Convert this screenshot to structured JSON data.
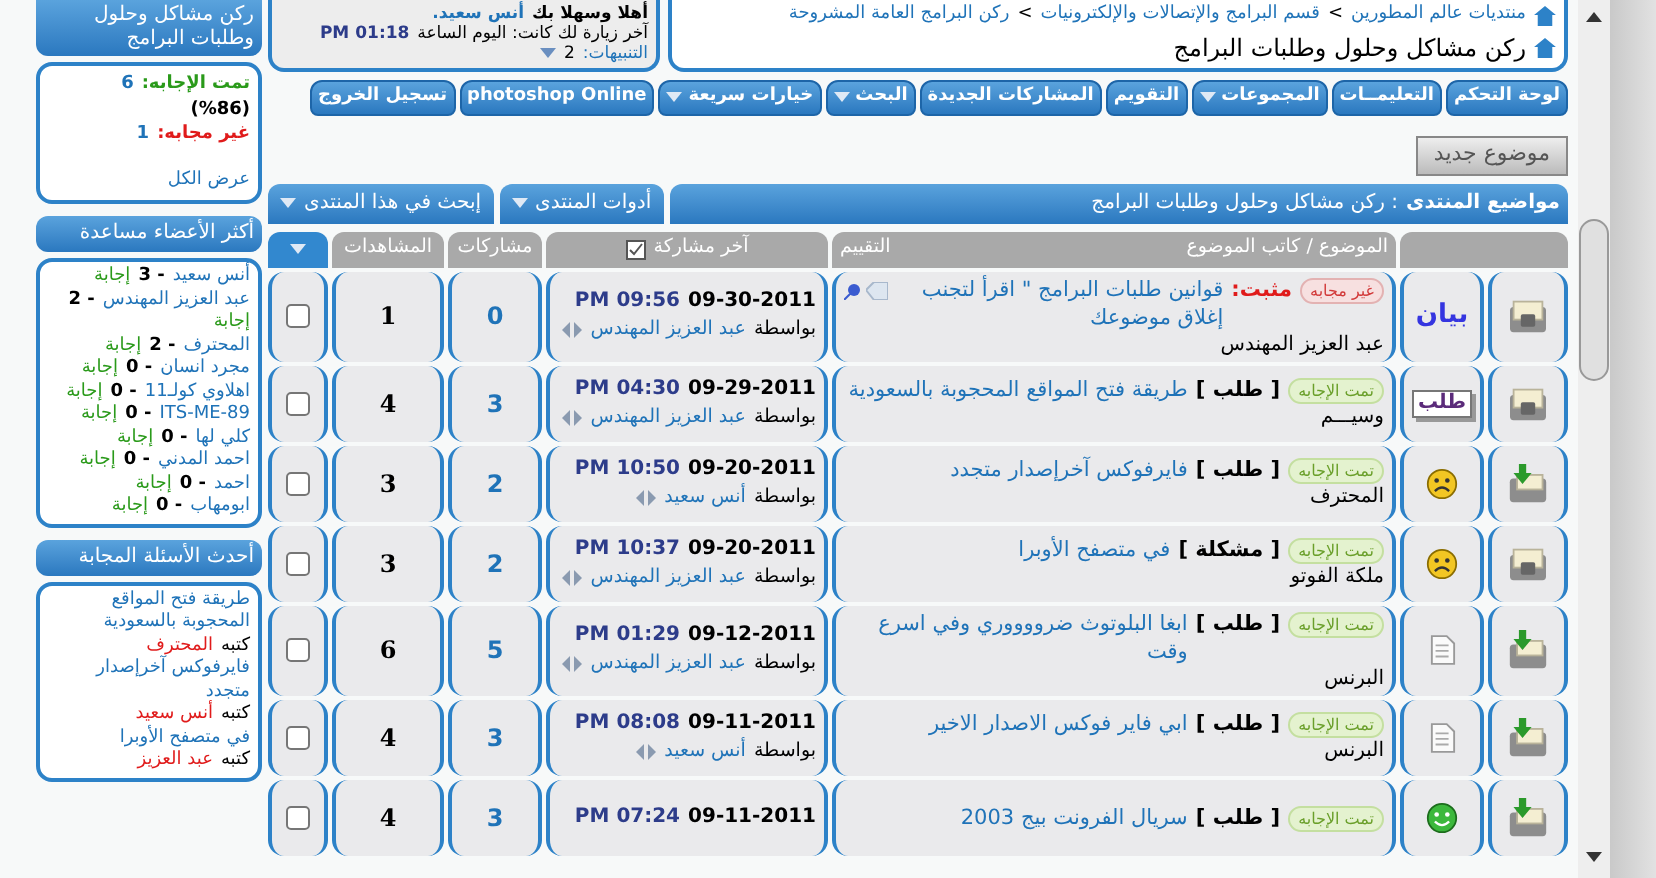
{
  "breadcrumb": {
    "links": [
      "منتديات عالم المطورين",
      "قسم البرامج والإتصالات والإلكترونيات",
      "ركن البرامج العامة المشروحة"
    ],
    "separator": ">",
    "current": "ركن مشاكل وحلول وطلبات البرامج"
  },
  "welcome": {
    "greeting": "أهلا وسهلا بك",
    "user": "أنس سعيد.",
    "last_visit_label": "آخر زيارة لك كانت: اليوم الساعة",
    "last_visit_time": "01:18 PM",
    "notifications_label": "التنبيهات:",
    "notifications_count": "2"
  },
  "navbar": [
    {
      "label": "لوحة التحكم",
      "dropdown": false
    },
    {
      "label": "التعليمــات",
      "dropdown": false
    },
    {
      "label": "المجموعات",
      "dropdown": true
    },
    {
      "label": "التقويم",
      "dropdown": false
    },
    {
      "label": "المشاركات الجديدة",
      "dropdown": false
    },
    {
      "label": "البحث",
      "dropdown": true
    },
    {
      "label": "خيارات سريعة",
      "dropdown": true
    },
    {
      "label": "photoshop Online",
      "dropdown": false
    },
    {
      "label": "تسجيل الخروج",
      "dropdown": false
    }
  ],
  "new_topic_button": "موضوع جديد",
  "forum_bar": {
    "label": "مواضيع المنتدى",
    "title": ": ركن مشاكل وحلول وطلبات البرامج",
    "buttons": [
      {
        "label": "أدوات المنتدى",
        "dropdown": true
      },
      {
        "label": "إبحث في هذا المنتدى",
        "dropdown": true
      }
    ]
  },
  "table": {
    "columns": {
      "subject": "الموضوع / كاتب الموضوع",
      "rating": "التقييم",
      "last_post": "آخر مشاركة",
      "posts": "مشاركات",
      "views": "المشاهدات"
    },
    "rows": [
      {
        "kind": "locked",
        "prefix": {
          "kind": "text",
          "label": "بيان"
        },
        "badge": {
          "kind": "unanswered",
          "label": "غير مجابه"
        },
        "sticky": "مثبت:",
        "title": "قوانين طلبات البرامج \" اقرأ لتجنب إغلاق موضوعك",
        "author": "عبد العزيز المهندس",
        "pinned": true,
        "date": "09-30-2011",
        "time": "09:56 PM",
        "by": "بواسطة",
        "last_poster": "عبد العزيز المهندس",
        "posts": "0",
        "views": "1",
        "checked": false
      },
      {
        "kind": "locked",
        "prefix": {
          "kind": "label",
          "label": "طلب"
        },
        "badge": {
          "kind": "answered",
          "label": "تمت الإجابه"
        },
        "tag": "[ طلب ]",
        "title": "طريقة فتح المواقع المحجوبة بالسعودية",
        "author": "وسيـــم",
        "pinned": false,
        "date": "09-29-2011",
        "time": "04:30 PM",
        "by": "بواسطة",
        "last_poster": "عبد العزيز المهندس",
        "posts": "3",
        "views": "4",
        "checked": false
      },
      {
        "kind": "new",
        "prefix": {
          "kind": "sad"
        },
        "badge": {
          "kind": "answered",
          "label": "تمت الإجابه"
        },
        "tag": "[ طلب ]",
        "title": "فايرفوكس آخرإصدار متجدد",
        "author": "المحترف",
        "pinned": false,
        "date": "09-20-2011",
        "time": "10:50 PM",
        "by": "بواسطة",
        "last_poster": "أنس سعيد",
        "posts": "2",
        "views": "3",
        "checked": false
      },
      {
        "kind": "locked",
        "prefix": {
          "kind": "sad"
        },
        "badge": {
          "kind": "answered",
          "label": "تمت الإجابه"
        },
        "tag": "[ مشكلة ]",
        "title": "في متصفح الأوبرا",
        "author": "ملكة الفوتو",
        "pinned": false,
        "date": "09-20-2011",
        "time": "10:37 PM",
        "by": "بواسطة",
        "last_poster": "عبد العزيز المهندس",
        "posts": "2",
        "views": "3",
        "checked": false
      },
      {
        "kind": "new",
        "prefix": {
          "kind": "paper"
        },
        "badge": {
          "kind": "answered",
          "label": "تمت الإجابه"
        },
        "tag": "[ طلب ]",
        "title": "ابغا البلوتوث ضرووووري وفي اسرع وقت",
        "author": "البرنس",
        "pinned": false,
        "date": "09-12-2011",
        "time": "01:29 PM",
        "by": "بواسطة",
        "last_poster": "عبد العزيز المهندس",
        "posts": "5",
        "views": "6",
        "checked": false
      },
      {
        "kind": "new",
        "prefix": {
          "kind": "paper"
        },
        "badge": {
          "kind": "answered",
          "label": "تمت الإجابه"
        },
        "tag": "[ طلب ]",
        "title": "ابي فاير فوكس الاصدار الاخير",
        "author": "البرنس",
        "pinned": false,
        "date": "09-11-2011",
        "time": "08:08 PM",
        "by": "بواسطة",
        "last_poster": "أنس سعيد",
        "posts": "3",
        "views": "4",
        "checked": false
      },
      {
        "kind": "new",
        "prefix": {
          "kind": "smile"
        },
        "badge": {
          "kind": "answered",
          "label": "تمت الإجابه"
        },
        "tag": "[ طلب ]",
        "title": "سريال الفرونت بيج 2003",
        "pinned": false,
        "date": "09-11-2011",
        "time": "07:24 PM",
        "posts": "3",
        "views": "4",
        "checked": false
      }
    ]
  },
  "sidebar": {
    "title": "ركن مشاكل وحلول وطلبات البرامج",
    "stats": {
      "answered_label": "تمت الإجابه:",
      "answered_count": "6",
      "answered_pct": "(%86)",
      "unanswered_label": "غير مجابه:",
      "unanswered_count": "1",
      "view_all": "عرض الكل"
    },
    "helpers_title": "أكثر الأعضاء مساعدة",
    "helpers": [
      {
        "name": "أنس سعيد",
        "count": "- 3",
        "unit": "إجابة"
      },
      {
        "name": "عبد العزيز المهندس",
        "count": "- 2",
        "unit": "إجابة"
      },
      {
        "name": "المحترف",
        "count": "- 2",
        "unit": "إجابة"
      },
      {
        "name": "مجرد انسان",
        "count": "- 0",
        "unit": "إجابة"
      },
      {
        "name": "اهلاوي كولـ11",
        "count": "- 0",
        "unit": "إجابة"
      },
      {
        "name": "ITS-ME-89",
        "count": "- 0",
        "unit": "إجابة"
      },
      {
        "name": "كلي لها",
        "count": "- 0",
        "unit": "إجابة"
      },
      {
        "name": "احمد المدني",
        "count": "- 0",
        "unit": "إجابة"
      },
      {
        "name": "احمد",
        "count": "- 0",
        "unit": "إجابة"
      },
      {
        "name": "ابومهاب",
        "count": "- 0",
        "unit": "إجابة"
      }
    ],
    "recent_title": "أحدث الأسئلة المجابة",
    "recent": [
      {
        "title": "طريقة فتح المواقع المحجوبة بالسعودية",
        "by": "كتبه",
        "author": "المحترف"
      },
      {
        "title": "فايرفوكس آخرإصدار متجدد",
        "by": "كتبه",
        "author": "أنس سعيد"
      },
      {
        "title": "في متصفح الأوبرا",
        "by": "كتبه",
        "author": "عبد العزيز"
      }
    ]
  }
}
